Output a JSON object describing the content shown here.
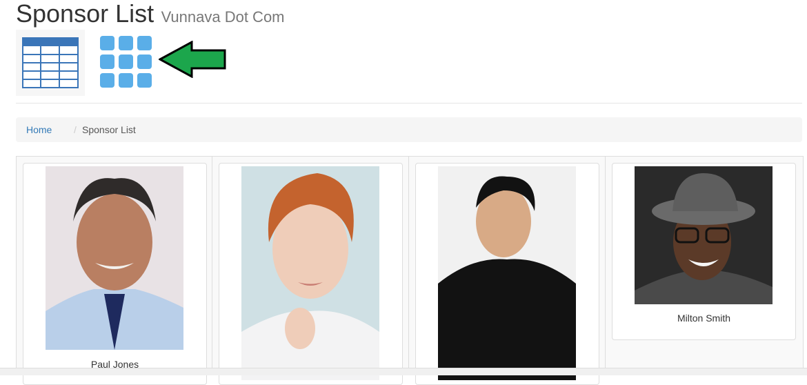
{
  "header": {
    "title": "Sponsor List",
    "subtitle": "Vunnava Dot Com"
  },
  "view_toggle": {
    "table_icon": "table-view-icon",
    "grid_icon": "grid-view-icon",
    "accent": "#5aaee8",
    "table_color": "#3a75b8"
  },
  "annotation": {
    "arrow_color": "#1ca64c"
  },
  "breadcrumb": {
    "home": "Home",
    "separator": "/",
    "current": "Sponsor List"
  },
  "sponsors": [
    {
      "name": "Paul Jones"
    },
    {
      "name": ""
    },
    {
      "name": ""
    },
    {
      "name": "Milton Smith"
    }
  ]
}
